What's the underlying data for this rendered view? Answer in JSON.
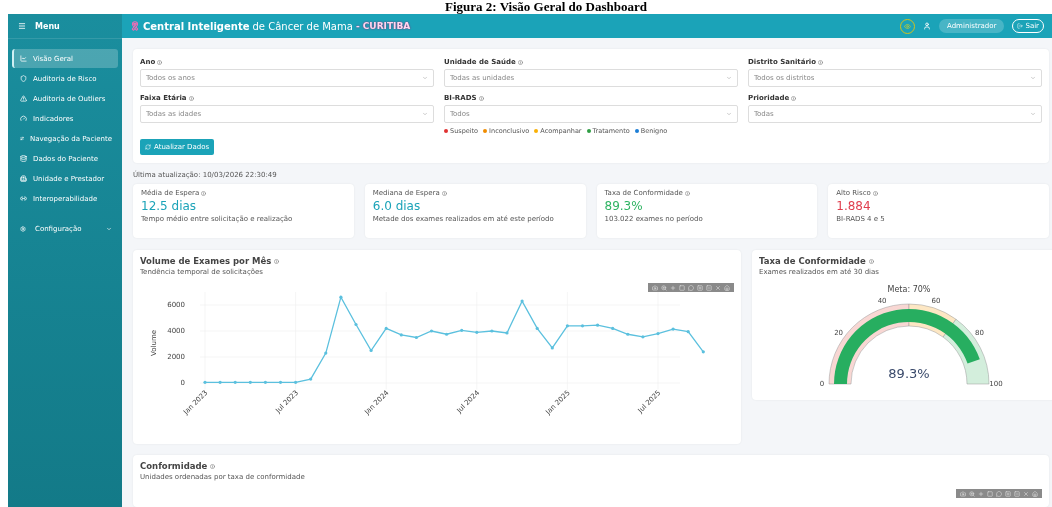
{
  "figure_caption": "Figura 2: Visão Geral do Dashboard",
  "sidebar": {
    "title": "Menu",
    "items": [
      {
        "label": "Visão Geral",
        "selected": true
      },
      {
        "label": "Auditoria de Risco",
        "selected": false
      },
      {
        "label": "Auditoria de Outliers",
        "selected": false
      },
      {
        "label": "Indicadores",
        "selected": false
      },
      {
        "label": "Navegação da Paciente",
        "selected": false
      },
      {
        "label": "Dados do Paciente",
        "selected": false
      },
      {
        "label": "Unidade e Prestador",
        "selected": false
      },
      {
        "label": "Interoperabilidade",
        "selected": false
      }
    ],
    "settings": {
      "label": "Configuração",
      "expanded": false
    }
  },
  "header": {
    "title_bold": "Central Inteligente",
    "title_rest": "de Câncer de Mama",
    "city": "- CURITIBA",
    "user": "Administrador",
    "logout": "Sair"
  },
  "filters": [
    {
      "label": "Ano",
      "placeholder": "Todos os anos"
    },
    {
      "label": "Unidade de Saúde",
      "placeholder": "Todas as unidades"
    },
    {
      "label": "Distrito Sanitário",
      "placeholder": "Todos os distritos"
    },
    {
      "label": "Faixa Etária",
      "placeholder": "Todas as idades"
    },
    {
      "label": "BI-RADS",
      "placeholder": "Todos",
      "legend": [
        {
          "label": "Suspeito",
          "color": "#e03131"
        },
        {
          "label": "Inconclusivo",
          "color": "#f08c00"
        },
        {
          "label": "Acompanhar",
          "color": "#fab005"
        },
        {
          "label": "Tratamento",
          "color": "#2f9e44"
        },
        {
          "label": "Benigno",
          "color": "#1c7ed6"
        }
      ]
    },
    {
      "label": "Prioridade",
      "placeholder": "Todas"
    }
  ],
  "refresh_button": "Atualizar Dados",
  "last_update": "Última atualização: 10/03/2026 22:30:49",
  "kpis": [
    {
      "title": "Média de Espera",
      "value": "12.5 dias",
      "note": "Tempo médio entre solicitação e realização",
      "color": "#1ba3b8"
    },
    {
      "title": "Mediana de Espera",
      "value": "6.0 dias",
      "note": "Metade dos exames realizados em até este período",
      "color": "#1ba3b8"
    },
    {
      "title": "Taxa de Conformidade",
      "value": "89.3%",
      "note": "103.022 exames no período",
      "color": "#2fb463"
    },
    {
      "title": "Alto Risco",
      "value": "1.884",
      "note": "BI-RADS 4 e 5",
      "color": "#e03e4e"
    }
  ],
  "volume_panel": {
    "title": "Volume de Exames por Mês",
    "subtitle": "Tendência temporal de solicitações",
    "chart_data": {
      "type": "line",
      "ylabel": "Volume",
      "categories": [
        "Jan 2023",
        null,
        null,
        null,
        null,
        null,
        "Jul 2023",
        null,
        null,
        null,
        null,
        null,
        "Jan 2024",
        null,
        null,
        null,
        null,
        null,
        "Jul 2024",
        null,
        null,
        null,
        null,
        null,
        "Jan 2025",
        null,
        null,
        null,
        null,
        null,
        "Jul 2025",
        null,
        null,
        null
      ],
      "values": [
        50,
        50,
        50,
        50,
        50,
        50,
        50,
        300,
        2300,
        6600,
        4500,
        2500,
        4200,
        3700,
        3500,
        4000,
        3750,
        4050,
        3900,
        4000,
        3850,
        6300,
        4200,
        2700,
        4400,
        4400,
        4450,
        4200,
        3750,
        3550,
        3800,
        4150,
        3950,
        2400
      ],
      "grid": true,
      "ylim": [
        -500,
        7000
      ],
      "yticks": [
        0,
        2000,
        4000,
        6000
      ]
    }
  },
  "gauge_panel": {
    "title": "Taxa de Conformidade",
    "subtitle": "Exames realizados em até 30 dias",
    "target_label": "Meta: 70%",
    "value": "89.3%",
    "ticks": [
      "0",
      "20",
      "40",
      "60",
      "80",
      "100"
    ]
  },
  "conformity_panel": {
    "title": "Conformidade",
    "subtitle": "Unidades ordenadas por taxa de conformidade"
  }
}
